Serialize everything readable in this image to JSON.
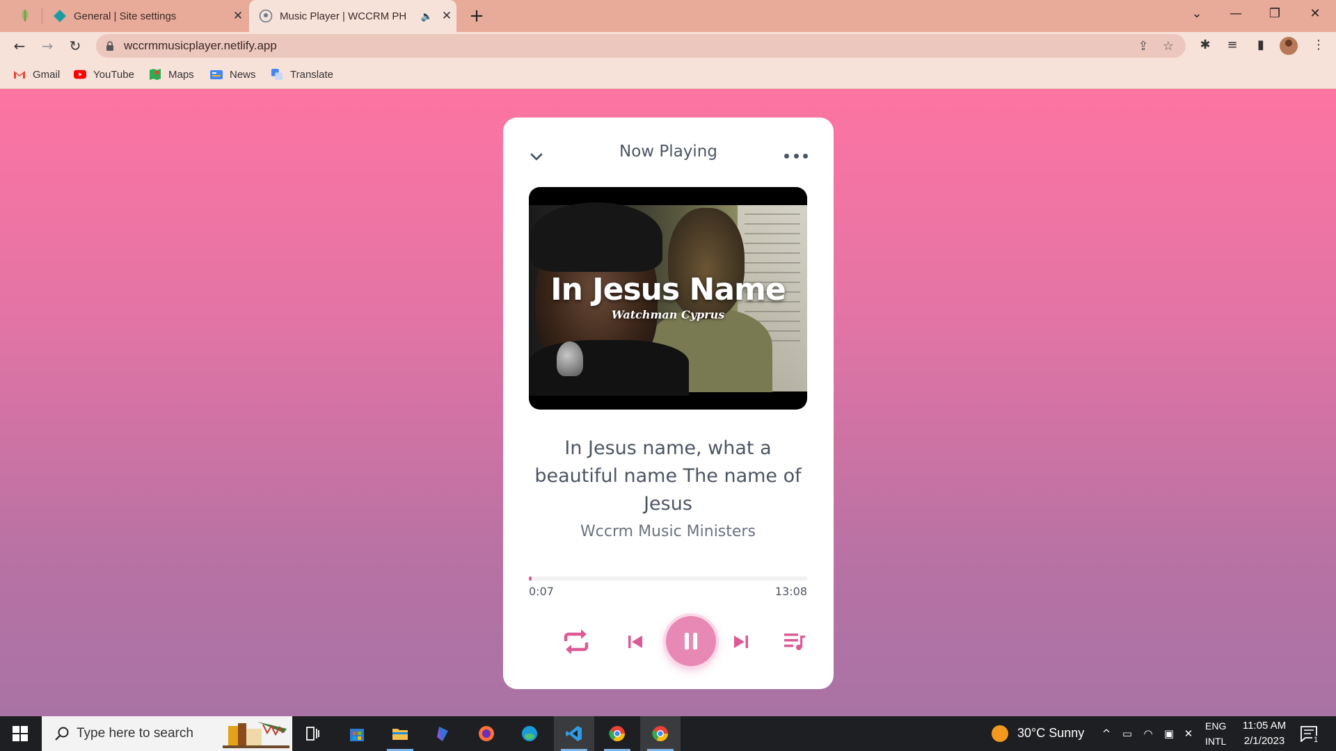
{
  "browser": {
    "tabs": [
      {
        "title": "General | Site settings",
        "close": "✕"
      },
      {
        "title": "Music Player | WCCRM PH",
        "close": "✕"
      }
    ],
    "new_tab": "+",
    "url": "wccrmmusicplayer.netlify.app",
    "window_controls": {
      "dropdown": "⌄",
      "minimize": "—",
      "restore": "❐",
      "close": "✕"
    },
    "bookmarks": [
      {
        "label": "Gmail",
        "icon": "gmail-icon"
      },
      {
        "label": "YouTube",
        "icon": "youtube-icon"
      },
      {
        "label": "Maps",
        "icon": "maps-icon"
      },
      {
        "label": "News",
        "icon": "news-icon"
      },
      {
        "label": "Translate",
        "icon": "translate-icon"
      }
    ]
  },
  "player": {
    "header_title": "Now Playing",
    "cover": {
      "title": "In Jesus Name",
      "subtitle": "Watchman Cyprus"
    },
    "song_title": "In Jesus name, what a beautiful name The name of Jesus",
    "artist": "Wccrm Music Ministers",
    "current_time": "0:07",
    "total_time": "13:08",
    "progress": 0.009,
    "controls": [
      "repeat-icon",
      "previous-icon",
      "pause-icon",
      "next-icon",
      "playlist-icon"
    ],
    "colors": {
      "accent": "#dd5a96",
      "button": "#e888b4",
      "bg_top": "#fd74a2",
      "bg_bottom": "#a873a4"
    }
  },
  "taskbar": {
    "search_placeholder": "Type here to search",
    "weather": "30°C  Sunny",
    "lang_top": "ENG",
    "lang_bottom": "INTL",
    "time": "11:05 AM",
    "date": "2/1/2023",
    "notification_count": "1"
  }
}
